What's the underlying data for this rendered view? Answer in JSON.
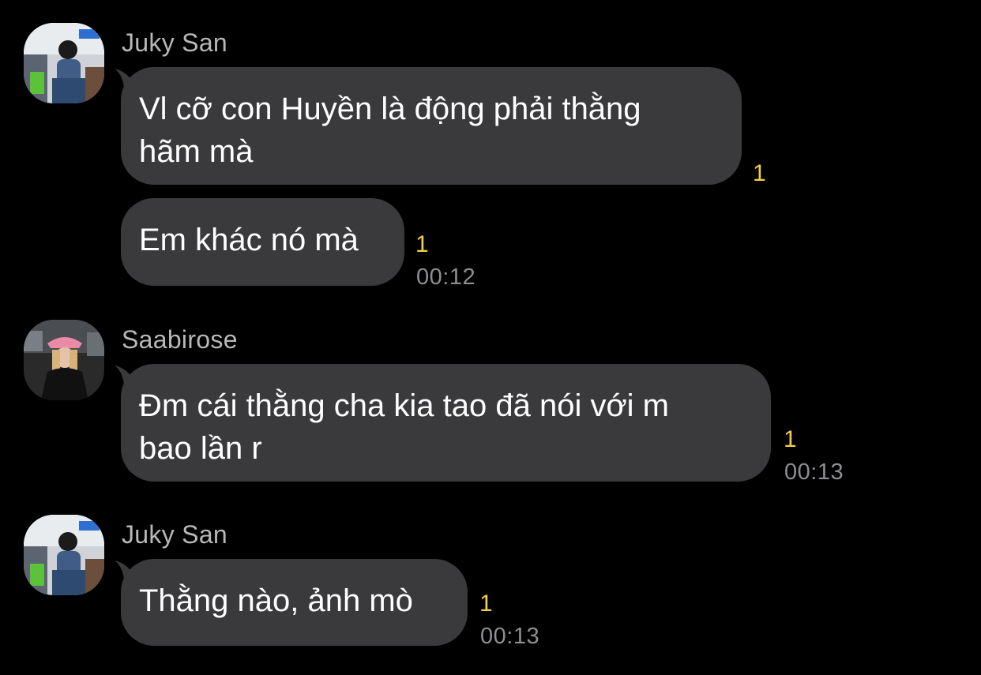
{
  "groups": [
    {
      "sender": "Juky San",
      "avatar_icon": "profile-photo-juky-san",
      "messages": [
        {
          "lines": [
            "Vl cỡ con Huyền là động phải thằng",
            "hãm mà"
          ],
          "unread": "1",
          "time": ""
        },
        {
          "lines": [
            "Em khác nó mà"
          ],
          "unread": "1",
          "time": "00:12"
        }
      ]
    },
    {
      "sender": "Saabirose",
      "avatar_icon": "profile-photo-saabirose",
      "messages": [
        {
          "lines": [
            "Đm cái thằng cha kia tao đã nói với m",
            "bao lần r"
          ],
          "unread": "1",
          "time": "00:13"
        }
      ]
    },
    {
      "sender": "Juky San",
      "avatar_icon": "profile-photo-juky-san",
      "messages": [
        {
          "lines": [
            "Thằng nào, ảnh mò"
          ],
          "unread": "1",
          "time": "00:13"
        }
      ]
    }
  ],
  "colors": {
    "background": "#000000",
    "bubble": "#3a3a3c",
    "message_text": "#ffffff",
    "sender_name": "#b8b8b8",
    "unread_count": "#f4d03f",
    "timestamp": "#8e8e93"
  }
}
